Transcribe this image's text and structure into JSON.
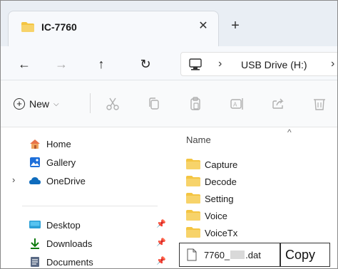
{
  "tab": {
    "title": "IC-7760",
    "close": "✕",
    "new_tab": "+"
  },
  "nav": {
    "back": "←",
    "forward": "→",
    "up": "↑",
    "refresh": "↻"
  },
  "address": {
    "separator": "›",
    "location": "USB Drive (H:)",
    "separator2": "›"
  },
  "command_bar": {
    "new_label": "New",
    "new_chevron": "⌵"
  },
  "sidebar": {
    "items": [
      {
        "label": "Home",
        "icon": "home-icon"
      },
      {
        "label": "Gallery",
        "icon": "gallery-icon"
      },
      {
        "label": "OneDrive",
        "icon": "cloud-icon",
        "expand": "›"
      },
      {
        "label": "Desktop",
        "icon": "desktop-icon",
        "pin": "📌"
      },
      {
        "label": "Downloads",
        "icon": "download-icon",
        "pin": "📌"
      },
      {
        "label": "Documents",
        "icon": "documents-icon",
        "pin": "📌"
      }
    ]
  },
  "content": {
    "column_header": "Name",
    "sort_indicator": "^",
    "folders": [
      "Capture",
      "Decode",
      "Setting",
      "Voice",
      "VoiceTx"
    ],
    "file": {
      "prefix": "7760_",
      "suffix": ".dat"
    }
  },
  "annotation": {
    "label": "Copy"
  },
  "colors": {
    "folder": "#f4c542",
    "accent": "#0067c0",
    "tabstrip": "#e9eef4"
  }
}
